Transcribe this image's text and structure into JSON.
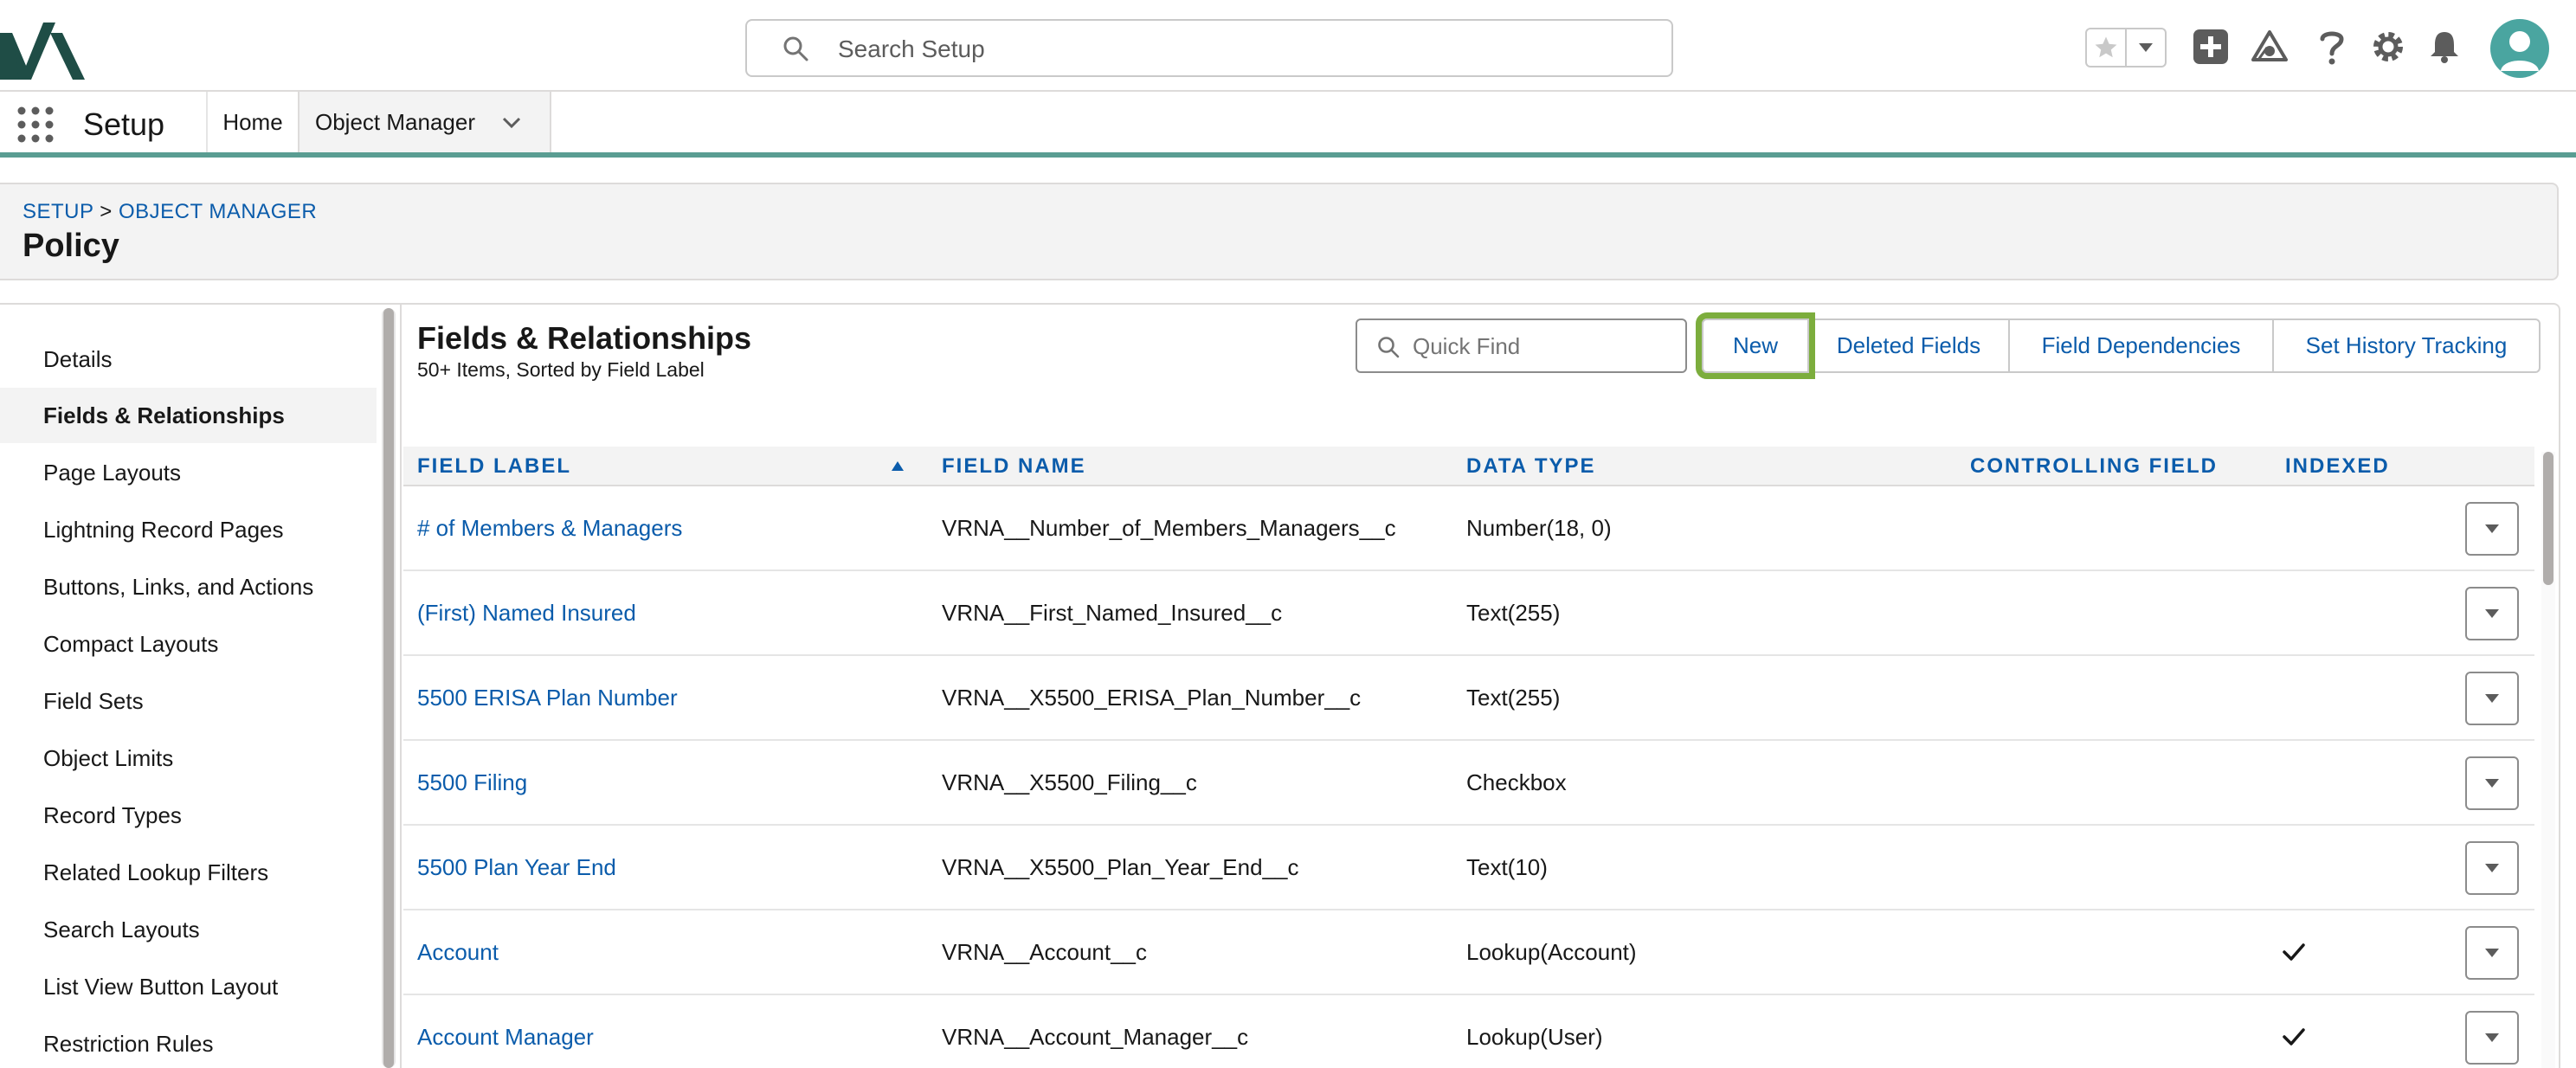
{
  "header": {
    "search_placeholder": "Search Setup",
    "icons": [
      "favorites-star-icon",
      "favorites-caret-icon",
      "global-add-icon",
      "trailhead-icon",
      "help-icon",
      "setup-gear-icon",
      "notifications-bell-icon",
      "user-avatar"
    ]
  },
  "context_bar": {
    "app_name": "Setup",
    "tabs": [
      {
        "label": "Home"
      },
      {
        "label": "Object Manager"
      }
    ]
  },
  "page_header": {
    "breadcrumb_setup": "SETUP",
    "breadcrumb_sep": " > ",
    "breadcrumb_om": "OBJECT MANAGER",
    "title": "Policy"
  },
  "sidebar": {
    "items": [
      {
        "label": "Details"
      },
      {
        "label": "Fields & Relationships"
      },
      {
        "label": "Page Layouts"
      },
      {
        "label": "Lightning Record Pages"
      },
      {
        "label": "Buttons, Links, and Actions"
      },
      {
        "label": "Compact Layouts"
      },
      {
        "label": "Field Sets"
      },
      {
        "label": "Object Limits"
      },
      {
        "label": "Record Types"
      },
      {
        "label": "Related Lookup Filters"
      },
      {
        "label": "Search Layouts"
      },
      {
        "label": "List View Button Layout"
      },
      {
        "label": "Restriction Rules"
      }
    ],
    "active_index": 1
  },
  "content": {
    "title": "Fields & Relationships",
    "subtitle": "50+ Items, Sorted by Field Label",
    "quick_find_placeholder": "Quick Find",
    "buttons": {
      "new": "New",
      "deleted_fields": "Deleted Fields",
      "field_dependencies": "Field Dependencies",
      "set_history_tracking": "Set History Tracking"
    }
  },
  "table": {
    "columns": {
      "field_label": "FIELD LABEL",
      "field_name": "FIELD NAME",
      "data_type": "DATA TYPE",
      "controlling_field": "CONTROLLING FIELD",
      "indexed": "INDEXED"
    },
    "rows": [
      {
        "label": "# of Members & Managers",
        "name": "VRNA__Number_of_Members_Managers__c",
        "type": "Number(18, 0)",
        "controlling": "",
        "indexed": false
      },
      {
        "label": "(First) Named Insured",
        "name": "VRNA__First_Named_Insured__c",
        "type": "Text(255)",
        "controlling": "",
        "indexed": false
      },
      {
        "label": "5500 ERISA Plan Number",
        "name": "VRNA__X5500_ERISA_Plan_Number__c",
        "type": "Text(255)",
        "controlling": "",
        "indexed": false
      },
      {
        "label": "5500 Filing",
        "name": "VRNA__X5500_Filing__c",
        "type": "Checkbox",
        "controlling": "",
        "indexed": false
      },
      {
        "label": "5500 Plan Year End",
        "name": "VRNA__X5500_Plan_Year_End__c",
        "type": "Text(10)",
        "controlling": "",
        "indexed": false
      },
      {
        "label": "Account",
        "name": "VRNA__Account__c",
        "type": "Lookup(Account)",
        "controlling": "",
        "indexed": true
      },
      {
        "label": "Account Manager",
        "name": "VRNA__Account_Manager__c",
        "type": "Lookup(User)",
        "controlling": "",
        "indexed": true
      }
    ]
  },
  "colors": {
    "link": "#0b5cab",
    "brand_teal": "#5a9d92",
    "highlight_green": "#7cad3d",
    "avatar": "#4aa5a0"
  }
}
